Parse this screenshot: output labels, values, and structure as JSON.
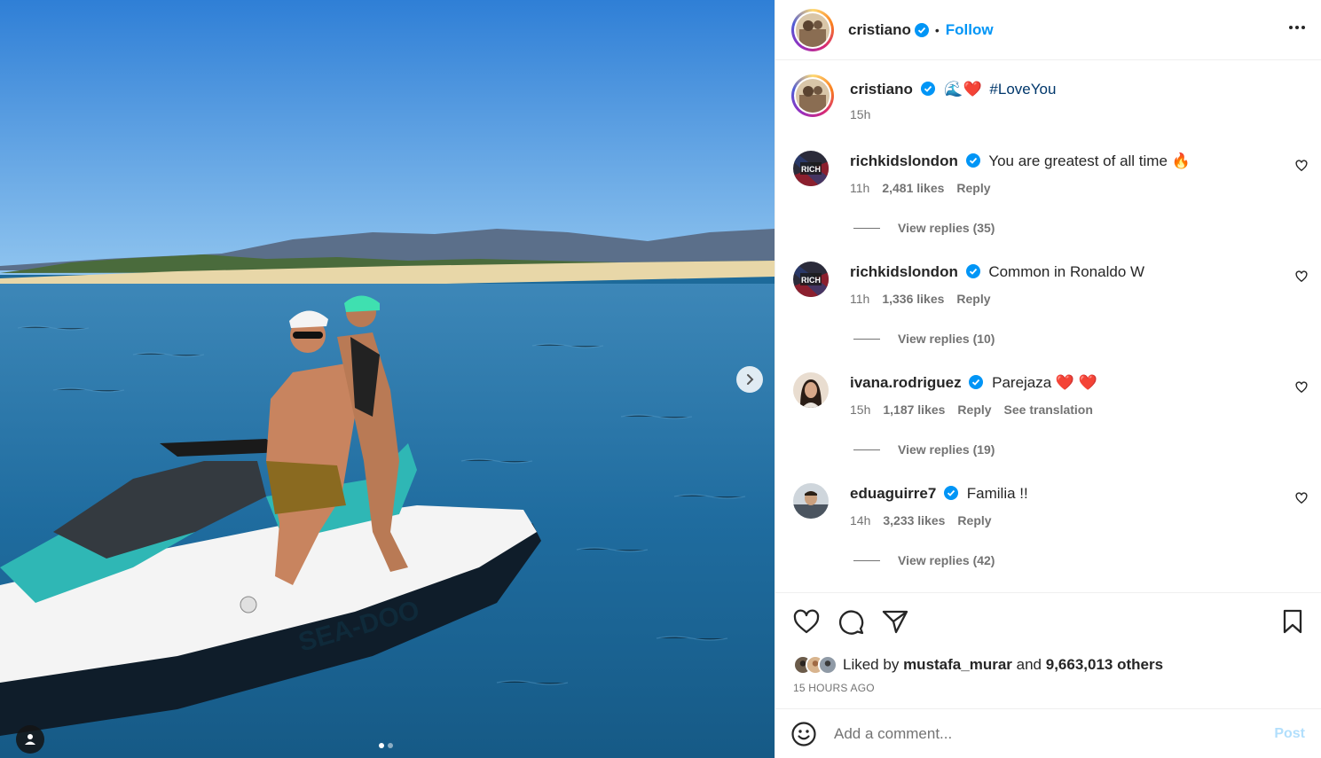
{
  "header": {
    "username": "cristiano",
    "separator": "•",
    "follow_label": "Follow",
    "more_icon": "more-horizontal-icon"
  },
  "caption": {
    "username": "cristiano",
    "emoji": "🌊❤️",
    "hashtag": "#LoveYou",
    "time": "15h"
  },
  "comments": [
    {
      "username": "richkidslondon",
      "text": "You are greatest of all time 🔥",
      "time": "11h",
      "likes": "2,481 likes",
      "reply": "Reply",
      "translation": "",
      "view_replies": "View replies (35)"
    },
    {
      "username": "richkidslondon",
      "text": "Common in Ronaldo W",
      "time": "11h",
      "likes": "1,336 likes",
      "reply": "Reply",
      "translation": "",
      "view_replies": "View replies (10)"
    },
    {
      "username": "ivana.rodriguez",
      "text": "Parejaza ❤️ ❤️",
      "time": "15h",
      "likes": "1,187 likes",
      "reply": "Reply",
      "translation": "See translation",
      "view_replies": "View replies (19)"
    },
    {
      "username": "eduaguirre7",
      "text": "Familia !!",
      "time": "14h",
      "likes": "3,233 likes",
      "reply": "Reply",
      "translation": "",
      "view_replies": "View replies (42)"
    }
  ],
  "likes": {
    "prefix": "Liked by",
    "user": "mustafa_murar",
    "and": "and",
    "others": "9,663,013 others",
    "time_ago": "15 HOURS AGO"
  },
  "comment_bar": {
    "placeholder": "Add a comment...",
    "post_label": "Post"
  },
  "carousel": {
    "current": 1,
    "total": 2
  },
  "colors": {
    "accent": "#0095f6",
    "text": "#262626",
    "muted": "#737373",
    "post_disabled": "#b2dffc"
  }
}
